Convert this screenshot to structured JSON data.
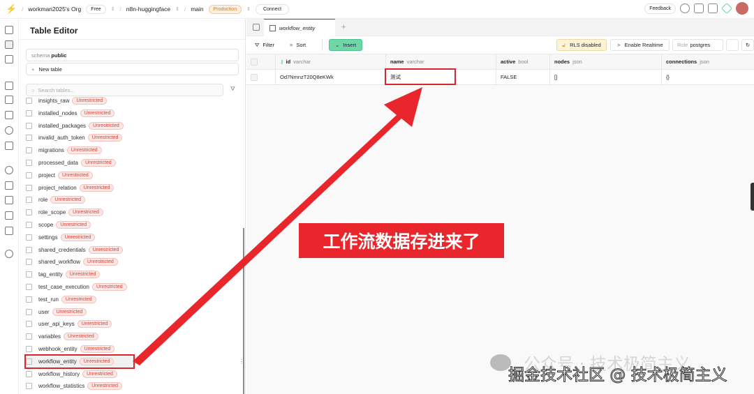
{
  "topbar": {
    "org": "workman2025's Org",
    "plan": "Free",
    "project": "n8n-huggingface",
    "branch": "main",
    "env": "Production",
    "connect": "Connect",
    "feedback": "Feedback"
  },
  "sidebar": {
    "title": "Table Editor",
    "schema_label": "schema",
    "schema_value": "public",
    "new_table": "New table",
    "search_placeholder": "Search tables...",
    "tables": [
      {
        "name": "insights_raw"
      },
      {
        "name": "installed_nodes"
      },
      {
        "name": "installed_packages"
      },
      {
        "name": "invalid_auth_token"
      },
      {
        "name": "migrations"
      },
      {
        "name": "processed_data"
      },
      {
        "name": "project"
      },
      {
        "name": "project_relation"
      },
      {
        "name": "role"
      },
      {
        "name": "role_scope"
      },
      {
        "name": "scope"
      },
      {
        "name": "settings"
      },
      {
        "name": "shared_credentials"
      },
      {
        "name": "shared_workflow"
      },
      {
        "name": "tag_entity"
      },
      {
        "name": "test_case_execution"
      },
      {
        "name": "test_run"
      },
      {
        "name": "user"
      },
      {
        "name": "user_api_keys"
      },
      {
        "name": "variables"
      },
      {
        "name": "webhook_entity"
      },
      {
        "name": "workflow_entity",
        "selected": true
      },
      {
        "name": "workflow_history"
      },
      {
        "name": "workflow_statistics"
      }
    ],
    "badge": "Unrestricted"
  },
  "main": {
    "tab": "workflow_entity",
    "filter": "Filter",
    "sort": "Sort",
    "insert": "Insert",
    "rls": "RLS disabled",
    "realtime": "Enable Realtime",
    "role_label": "Role",
    "role_value": "postgres",
    "columns": [
      {
        "name": "id",
        "type": "varchar"
      },
      {
        "name": "name",
        "type": "varchar"
      },
      {
        "name": "active",
        "type": "bool"
      },
      {
        "name": "nodes",
        "type": "json"
      },
      {
        "name": "connections",
        "type": "json"
      }
    ],
    "rows": [
      [
        "Od7NmnzT20Q8eKWk",
        "测试",
        "FALSE",
        "[]",
        "{}"
      ]
    ]
  },
  "annotation": {
    "callout": "工作流数据存进来了",
    "color": "#e8262b"
  },
  "watermark": {
    "line1": "公众号 · 技术极简主义",
    "line2": "掘金技术社区 @ 技术极简主义"
  }
}
